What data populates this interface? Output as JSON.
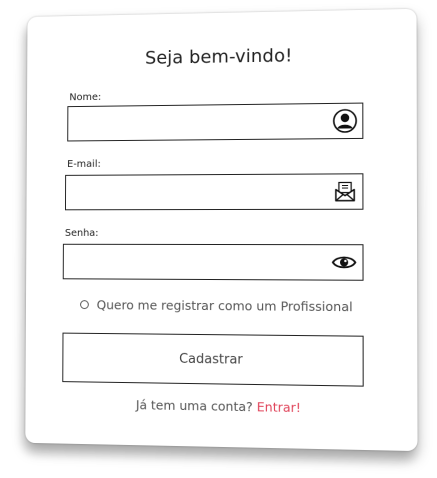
{
  "form": {
    "title": "Seja bem-vindo!",
    "fields": {
      "name": {
        "label": "Nome:",
        "value": "",
        "placeholder": ""
      },
      "email": {
        "label": "E-mail:",
        "value": "",
        "placeholder": ""
      },
      "password": {
        "label": "Senha:",
        "value": "",
        "placeholder": ""
      }
    },
    "professional_option": "Quero me registrar como um Profissional",
    "submit_label": "Cadastrar",
    "footer_prefix": "Já  tem uma conta?",
    "footer_link": "Entrar!"
  },
  "icons": {
    "name_field_icon": "user-icon",
    "email_field_icon": "mail-icon",
    "password_field_icon": "eye-icon"
  },
  "colors": {
    "link": "#e0445a",
    "border": "#222222",
    "text": "#222222"
  }
}
